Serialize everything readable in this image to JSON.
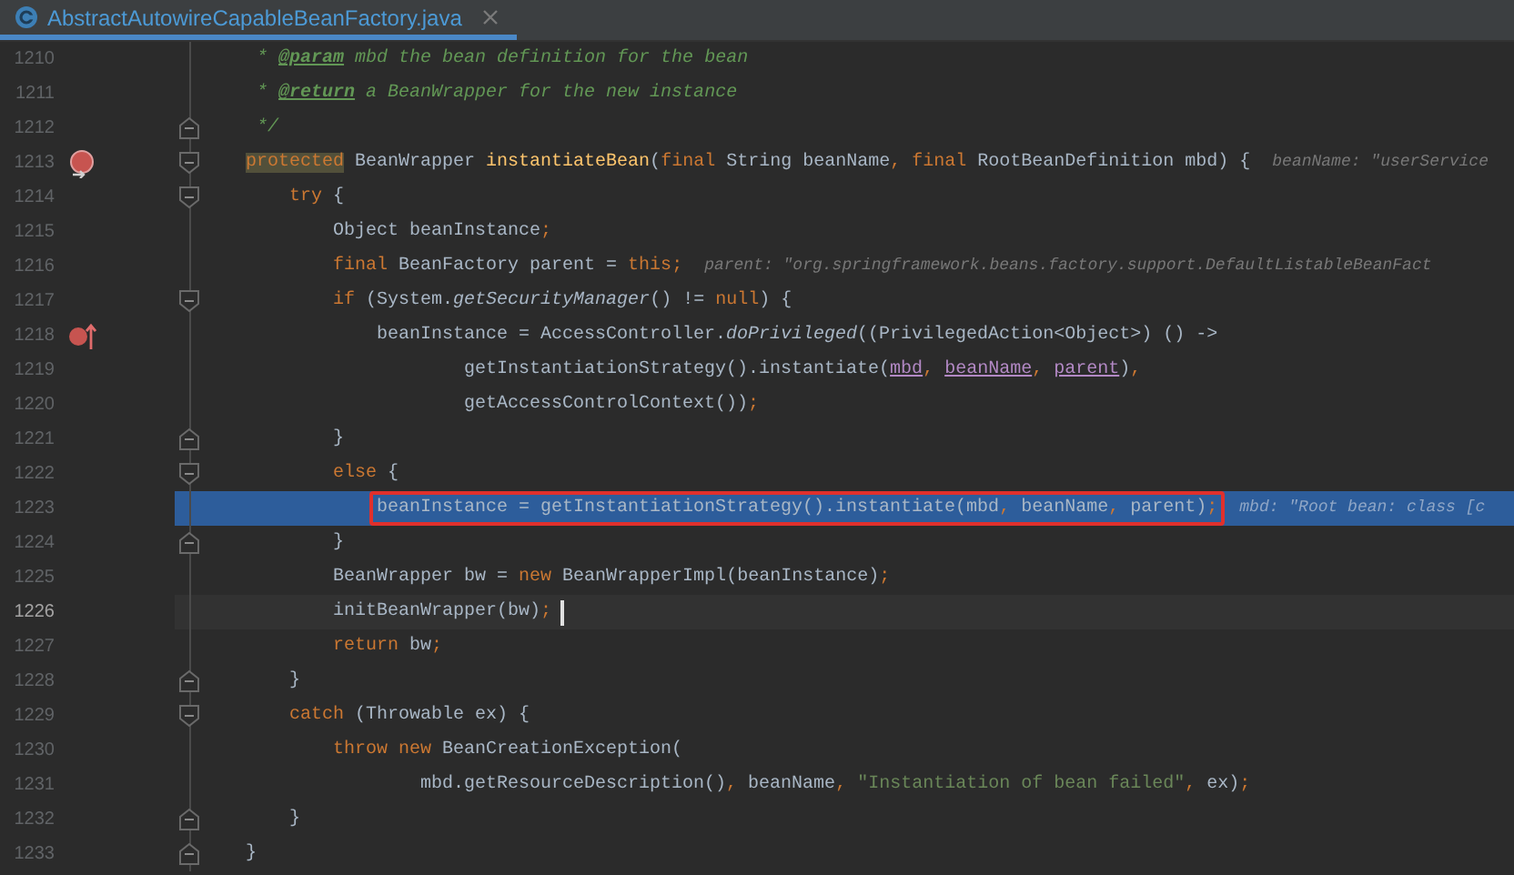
{
  "tab": {
    "title": "AbstractAutowireCapableBeanFactory.java",
    "selected": true
  },
  "lines": [
    {
      "number": "1210",
      "kind": "doc",
      "highlighted": false,
      "current": false,
      "outlined": false,
      "tokens": [
        {
          "kind": "comment",
          "text": "* "
        },
        {
          "kind": "doctag",
          "text": "@param"
        },
        {
          "kind": "comment",
          "text": " mbd the bean definition for the bean"
        }
      ]
    },
    {
      "number": "1211",
      "kind": "doc",
      "highlighted": false,
      "current": false,
      "outlined": false,
      "tokens": [
        {
          "kind": "comment",
          "text": "* "
        },
        {
          "kind": "doctag",
          "text": "@return"
        },
        {
          "kind": "comment",
          "text": " a BeanWrapper for the new instance"
        }
      ]
    },
    {
      "number": "1212",
      "kind": "doc",
      "highlighted": false,
      "current": false,
      "outlined": false,
      "fold": {
        "kind": "end"
      },
      "tokens": [
        {
          "kind": "comment",
          "text": "*/"
        }
      ]
    },
    {
      "number": "1213",
      "kind": "statement",
      "highlighted": false,
      "current": false,
      "outlined": false,
      "fold": {
        "kind": "start"
      },
      "gutter_icon": {
        "kind": "override"
      },
      "tokens": [
        {
          "kind": "keyword_usage",
          "text": "protected"
        },
        {
          "kind": "plain",
          "text": " BeanWrapper "
        },
        {
          "kind": "declaration",
          "text": "instantiateBean"
        },
        {
          "kind": "plain",
          "text": "("
        },
        {
          "kind": "keyword",
          "text": "final"
        },
        {
          "kind": "plain",
          "text": " String beanName"
        },
        {
          "kind": "punct",
          "text": ","
        },
        {
          "kind": "keyword",
          "text": " final"
        },
        {
          "kind": "plain",
          "text": " RootBeanDefinition mbd) {"
        }
      ],
      "hint": "beanName: \"userService",
      "children": [
        {
          "number": "1214",
          "kind": "statement",
          "highlighted": false,
          "current": false,
          "outlined": false,
          "fold": {
            "kind": "start"
          },
          "tokens": [
            {
              "kind": "keyword",
              "text": "try"
            },
            {
              "kind": "plain",
              "text": " {"
            }
          ],
          "children": [
            {
              "number": "1215",
              "kind": "statement",
              "highlighted": false,
              "current": false,
              "outlined": false,
              "tokens": [
                {
                  "kind": "plain",
                  "text": "Object beanInstance"
                },
                {
                  "kind": "punct",
                  "text": ";"
                }
              ]
            },
            {
              "number": "1216",
              "kind": "statement",
              "highlighted": false,
              "current": false,
              "outlined": false,
              "tokens": [
                {
                  "kind": "keyword",
                  "text": "final"
                },
                {
                  "kind": "plain",
                  "text": " BeanFactory parent = "
                },
                {
                  "kind": "keyword",
                  "text": "this"
                },
                {
                  "kind": "punct",
                  "text": ";"
                }
              ],
              "hint": "parent: \"org.springframework.beans.factory.support.DefaultListableBeanFact"
            },
            {
              "number": "1217",
              "kind": "statement",
              "highlighted": false,
              "current": false,
              "outlined": false,
              "fold": {
                "kind": "start"
              },
              "tokens": [
                {
                  "kind": "keyword",
                  "text": "if"
                },
                {
                  "kind": "plain",
                  "text": " (System."
                },
                {
                  "kind": "static",
                  "text": "getSecurityManager"
                },
                {
                  "kind": "plain",
                  "text": "() != "
                },
                {
                  "kind": "keyword",
                  "text": "null"
                },
                {
                  "kind": "plain",
                  "text": ") {"
                }
              ],
              "children": [
                {
                  "number": "1218",
                  "kind": "statement",
                  "highlighted": false,
                  "current": false,
                  "outlined": false,
                  "gutter_icon": {
                    "kind": "lambda"
                  },
                  "tokens": [
                    {
                      "kind": "plain",
                      "text": "beanInstance = AccessController."
                    },
                    {
                      "kind": "static",
                      "text": "doPrivileged"
                    },
                    {
                      "kind": "plain",
                      "text": "((PrivilegedAction<Object>) () ->"
                    }
                  ],
                  "children": [
                    {
                      "number": "1219",
                      "kind": "continuation",
                      "highlighted": false,
                      "current": false,
                      "outlined": false,
                      "tokens": [
                        {
                          "kind": "plain",
                          "text": "getInstantiationStrategy().instantiate("
                        },
                        {
                          "kind": "param",
                          "text": "mbd"
                        },
                        {
                          "kind": "punct",
                          "text": ", "
                        },
                        {
                          "kind": "param",
                          "text": "beanName"
                        },
                        {
                          "kind": "punct",
                          "text": ", "
                        },
                        {
                          "kind": "param",
                          "text": "parent"
                        },
                        {
                          "kind": "plain",
                          "text": ")"
                        },
                        {
                          "kind": "punct",
                          "text": ","
                        }
                      ]
                    },
                    {
                      "number": "1220",
                      "kind": "continuation",
                      "highlighted": false,
                      "current": false,
                      "outlined": false,
                      "tokens": [
                        {
                          "kind": "plain",
                          "text": "getAccessControlContext())"
                        },
                        {
                          "kind": "punct",
                          "text": ";"
                        }
                      ]
                    }
                  ]
                }
              ]
            },
            {
              "number": "1221",
              "kind": "statement",
              "highlighted": false,
              "current": false,
              "outlined": false,
              "fold": {
                "kind": "end"
              },
              "tokens": [
                {
                  "kind": "plain",
                  "text": "}"
                }
              ]
            },
            {
              "number": "1222",
              "kind": "statement",
              "highlighted": false,
              "current": false,
              "outlined": false,
              "fold": {
                "kind": "start"
              },
              "tokens": [
                {
                  "kind": "keyword",
                  "text": "else"
                },
                {
                  "kind": "plain",
                  "text": " {"
                }
              ],
              "children": [
                {
                  "number": "1223",
                  "kind": "statement",
                  "highlighted": true,
                  "current": false,
                  "outlined": true,
                  "tokens": [
                    {
                      "kind": "plain",
                      "text": "beanInstance = getInstantiationStrategy().instantiate(mbd"
                    },
                    {
                      "kind": "punct",
                      "text": ","
                    },
                    {
                      "kind": "plain",
                      "text": " beanName"
                    },
                    {
                      "kind": "punct",
                      "text": ","
                    },
                    {
                      "kind": "plain",
                      "text": " parent)"
                    },
                    {
                      "kind": "punct",
                      "text": ";"
                    }
                  ],
                  "hint": "mbd: \"Root bean: class [c"
                }
              ]
            },
            {
              "number": "1224",
              "kind": "statement",
              "highlighted": false,
              "current": false,
              "outlined": false,
              "fold": {
                "kind": "end"
              },
              "tokens": [
                {
                  "kind": "plain",
                  "text": "}"
                }
              ]
            },
            {
              "number": "1225",
              "kind": "statement",
              "highlighted": false,
              "current": false,
              "outlined": false,
              "tokens": [
                {
                  "kind": "plain",
                  "text": "BeanWrapper bw = "
                },
                {
                  "kind": "keyword",
                  "text": "new"
                },
                {
                  "kind": "plain",
                  "text": " BeanWrapperImpl(beanInstance)"
                },
                {
                  "kind": "punct",
                  "text": ";"
                }
              ]
            },
            {
              "number": "1226",
              "kind": "statement",
              "highlighted": false,
              "current": true,
              "outlined": false,
              "tokens": [
                {
                  "kind": "plain",
                  "text": "initBeanWrapper(bw)"
                },
                {
                  "kind": "punct",
                  "text": ";"
                }
              ]
            },
            {
              "number": "1227",
              "kind": "statement",
              "highlighted": false,
              "current": false,
              "outlined": false,
              "tokens": [
                {
                  "kind": "keyword",
                  "text": "return"
                },
                {
                  "kind": "plain",
                  "text": " bw"
                },
                {
                  "kind": "punct",
                  "text": ";"
                }
              ]
            }
          ]
        },
        {
          "number": "1228",
          "kind": "statement",
          "highlighted": false,
          "current": false,
          "outlined": false,
          "fold": {
            "kind": "end"
          },
          "tokens": [
            {
              "kind": "plain",
              "text": "}"
            }
          ]
        },
        {
          "number": "1229",
          "kind": "statement",
          "highlighted": false,
          "current": false,
          "outlined": false,
          "fold": {
            "kind": "start"
          },
          "tokens": [
            {
              "kind": "keyword",
              "text": "catch"
            },
            {
              "kind": "plain",
              "text": " (Throwable ex) {"
            }
          ],
          "children": [
            {
              "number": "1230",
              "kind": "statement",
              "highlighted": false,
              "current": false,
              "outlined": false,
              "tokens": [
                {
                  "kind": "keyword",
                  "text": "throw new"
                },
                {
                  "kind": "plain",
                  "text": " BeanCreationException("
                }
              ],
              "children": [
                {
                  "number": "1231",
                  "kind": "continuation",
                  "highlighted": false,
                  "current": false,
                  "outlined": false,
                  "tokens": [
                    {
                      "kind": "plain",
                      "text": "mbd.getResourceDescription()"
                    },
                    {
                      "kind": "punct",
                      "text": ","
                    },
                    {
                      "kind": "plain",
                      "text": " beanName"
                    },
                    {
                      "kind": "punct",
                      "text": ", "
                    },
                    {
                      "kind": "string",
                      "text": "\"Instantiation of bean failed\""
                    },
                    {
                      "kind": "punct",
                      "text": ","
                    },
                    {
                      "kind": "plain",
                      "text": " ex)"
                    },
                    {
                      "kind": "punct",
                      "text": ";"
                    }
                  ]
                }
              ]
            }
          ]
        },
        {
          "number": "1232",
          "kind": "statement",
          "highlighted": false,
          "current": false,
          "outlined": false,
          "fold": {
            "kind": "end"
          },
          "tokens": [
            {
              "kind": "plain",
              "text": "}"
            }
          ]
        }
      ]
    },
    {
      "number": "1233",
      "kind": "statement",
      "highlighted": false,
      "current": false,
      "outlined": false,
      "fold": {
        "kind": "end"
      },
      "tokens": [
        {
          "kind": "plain",
          "text": "}"
        }
      ]
    }
  ]
}
